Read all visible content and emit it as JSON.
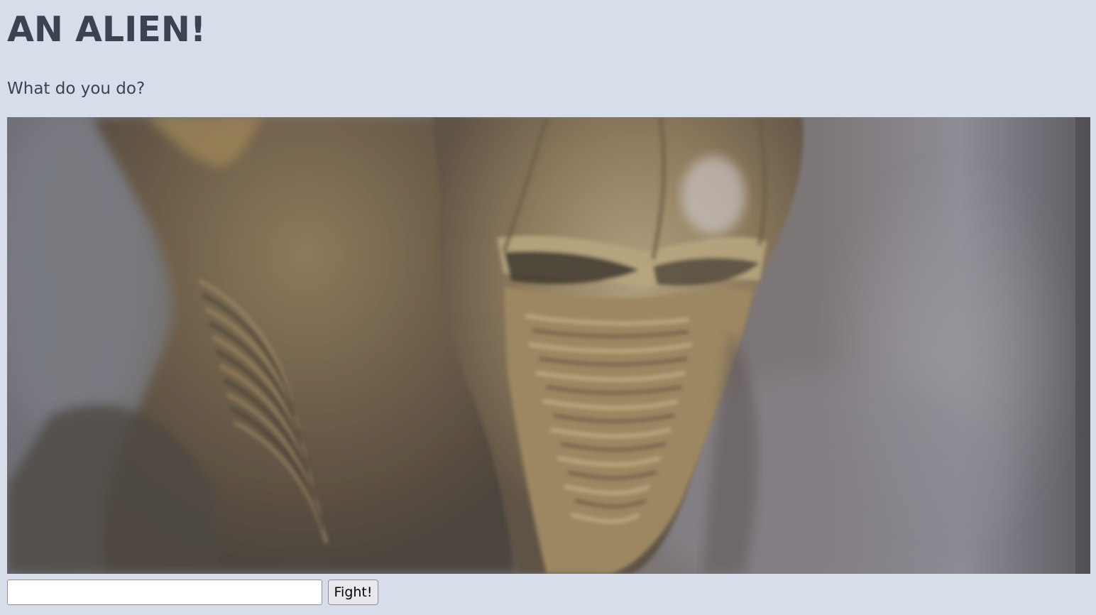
{
  "page": {
    "title": "AN ALIEN!",
    "prompt": "What do you do?"
  },
  "scene": {
    "image": "alien-creature-closeup",
    "palette": {
      "background": "#d8dee9",
      "heading": "#3b4252",
      "smoke": "#8a8890",
      "creature_skin": "#8c7a5e",
      "creature_shadow": "#4a4238"
    }
  },
  "form": {
    "input_value": "",
    "input_placeholder": "",
    "submit_label": "Fight!"
  }
}
